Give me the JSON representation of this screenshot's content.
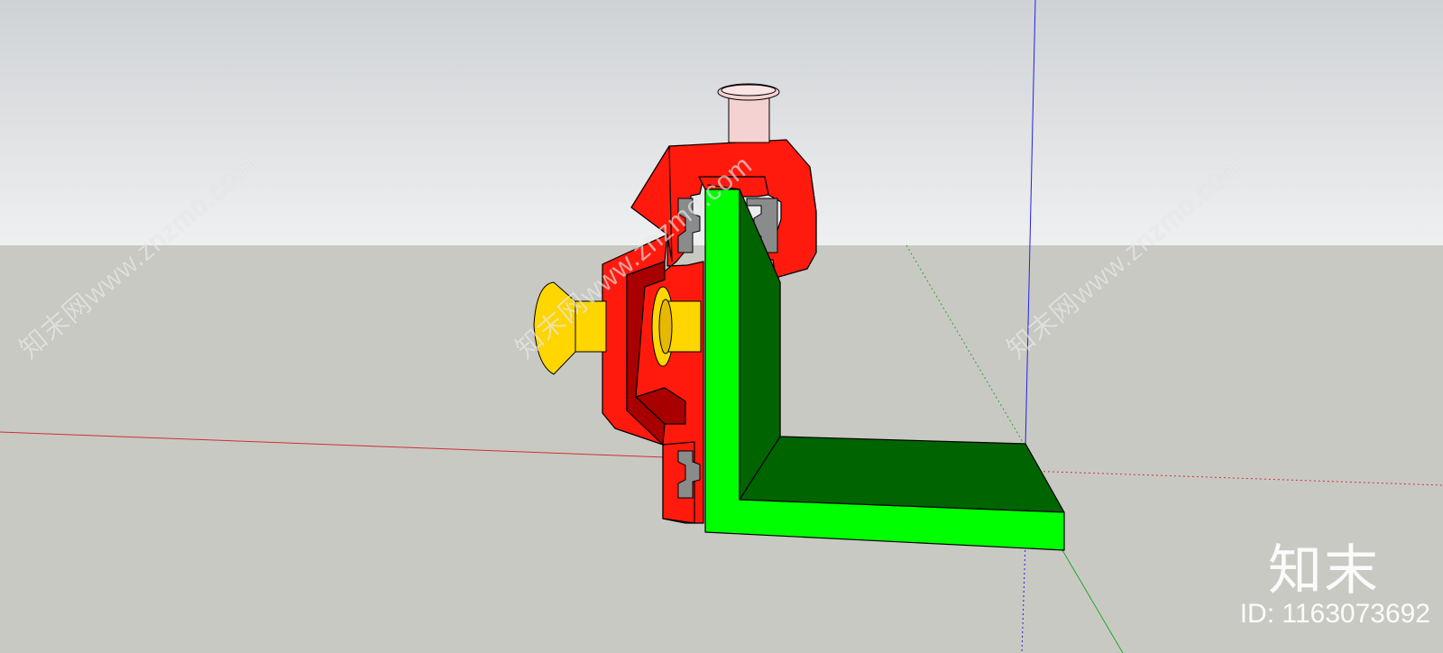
{
  "watermark": {
    "diagonal_text": "知末网www.znzmo.com",
    "logo": "知末",
    "id_label": "ID: 1163073692"
  },
  "colors": {
    "clamp": "#ff1a0d",
    "clamp_shadow": "#a80000",
    "angle_bracket": "#00ff00",
    "angle_bracket_shadow": "#006400",
    "knob": "#ffd600",
    "pin": "#f4d2d2",
    "slot_insert": "#8a8c8c",
    "axis_red": "#cc3333",
    "axis_green": "#22aa22",
    "axis_blue": "#2222dd"
  }
}
